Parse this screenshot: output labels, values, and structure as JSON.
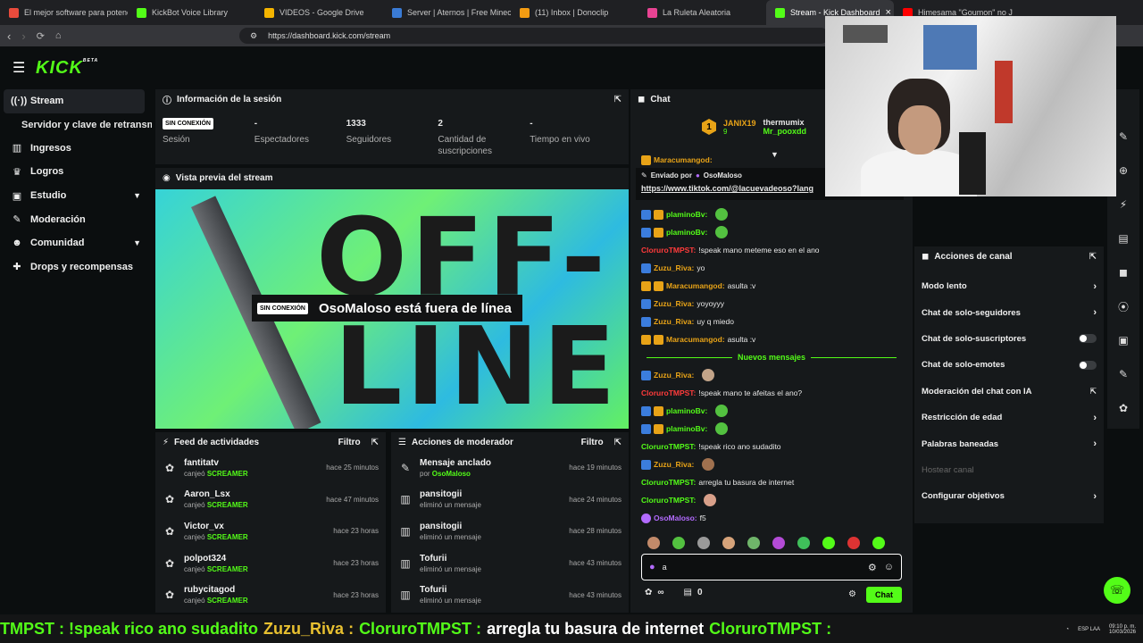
{
  "browser": {
    "tabs": [
      {
        "label": "El mejor software para potenci",
        "color": "#e84b3c"
      },
      {
        "label": "KickBot Voice Library",
        "color": "#53fc18"
      },
      {
        "label": "VIDEOS - Google Drive",
        "color": "#f4b400"
      },
      {
        "label": "Server | Aternos | Free Minecra",
        "color": "#3a7bd5"
      },
      {
        "label": "(11) Inbox | Donoclip",
        "color": "#f39c12"
      },
      {
        "label": "La Ruleta Aleatoria",
        "color": "#e84393"
      },
      {
        "label": "Stream - Kick Dashboard",
        "color": "#53fc18"
      },
      {
        "label": "Himesama \"Goumon\" no J",
        "color": "#ff0000"
      }
    ],
    "url": "https://dashboard.kick.com/stream"
  },
  "logo": "KICK",
  "logo_sup": "BETA",
  "sidebar": {
    "items": [
      {
        "label": "Stream",
        "icon": "broadcast"
      },
      {
        "label": "Servidor y clave de retransm"
      },
      {
        "label": "Ingresos",
        "icon": "chart"
      },
      {
        "label": "Logros",
        "icon": "trophy"
      },
      {
        "label": "Estudio",
        "icon": "studio"
      },
      {
        "label": "Moderación",
        "icon": "wrench"
      },
      {
        "label": "Comunidad",
        "icon": "people"
      },
      {
        "label": "Drops y recompensas",
        "icon": "gift"
      }
    ]
  },
  "session": {
    "title": "Información de la sesión",
    "status_badge": "SIN CONEXIÓN",
    "cols": [
      {
        "value": "",
        "label": "Sesión"
      },
      {
        "value": "-",
        "label": "Espectadores"
      },
      {
        "value": "1333",
        "label": "Seguidores"
      },
      {
        "value": "2",
        "label": "Cantidad de suscripciones"
      },
      {
        "value": "-",
        "label": "Tiempo en vivo"
      }
    ]
  },
  "preview": {
    "title": "Vista previa del stream",
    "badge": "SIN CONEXIÓN",
    "offline_text": "OsoMaloso está fuera de línea",
    "big_line1": "OFF-",
    "big_line2": "LINE"
  },
  "feed": {
    "title": "Feed de actividades",
    "filter": "Filtro",
    "rows": [
      {
        "name": "fantitatv",
        "action": "canjeó",
        "item": "SCREAMER",
        "time": "hace 25 minutos"
      },
      {
        "name": "Aaron_Lsx",
        "action": "canjeó",
        "item": "SCREAMER",
        "time": "hace 47 minutos"
      },
      {
        "name": "Victor_vx",
        "action": "canjeó",
        "item": "SCREAMER",
        "time": "hace 23 horas"
      },
      {
        "name": "polpot324",
        "action": "canjeó",
        "item": "SCREAMER",
        "time": "hace 23 horas"
      },
      {
        "name": "rubycitagod",
        "action": "canjeó",
        "item": "SCREAMER",
        "time": "hace 23 horas"
      }
    ]
  },
  "mod": {
    "title": "Acciones de moderador",
    "filter": "Filtro",
    "rows": [
      {
        "name": "Mensaje anclado",
        "action": "por",
        "item": "OsoMaloso",
        "time": "hace 19 minutos",
        "icon": "pin"
      },
      {
        "name": "pansitogii",
        "action": "eliminó un mensaje",
        "item": "",
        "time": "hace 24 minutos",
        "icon": "trash"
      },
      {
        "name": "pansitogii",
        "action": "eliminó un mensaje",
        "item": "",
        "time": "hace 28 minutos",
        "icon": "trash"
      },
      {
        "name": "Tofurii",
        "action": "eliminó un mensaje",
        "item": "",
        "time": "hace 43 minutos",
        "icon": "trash"
      },
      {
        "name": "Tofurii",
        "action": "eliminó un mensaje",
        "item": "",
        "time": "hace 43 minutos",
        "icon": "trash"
      }
    ]
  },
  "chat": {
    "title": "Chat",
    "top_gifter": {
      "rank": "1",
      "name": "JANIX19",
      "count": "9"
    },
    "gifters": [
      "thermumix",
      "Mr_pooxdd"
    ],
    "partial_top": "Maracumangod:",
    "pinned_by_label": "Enviado por",
    "pinned_by": "OsoMaloso",
    "pinned_link": "https://www.tiktok.com/@lacuevadeoso?lang",
    "messages": [
      {
        "user": "plaminoBv:",
        "text": "",
        "color": "#53fc18",
        "badges": [
          "blue",
          "gold"
        ],
        "emote": "#53c140"
      },
      {
        "user": "plaminoBv:",
        "text": "",
        "color": "#53fc18",
        "badges": [
          "blue",
          "gold"
        ],
        "emote": "#53c140"
      },
      {
        "user": "CloruroTMPST:",
        "text": "!speak mano meteme eso en el ano",
        "color": "#ff3b3b",
        "badges": []
      },
      {
        "user": "Zuzu_Riva:",
        "text": "yo",
        "color": "#e8a317",
        "badges": [
          "blue"
        ]
      },
      {
        "user": "Maracumangod:",
        "text": "asulta :v",
        "color": "#e8a317",
        "badges": [
          "gold",
          "gold"
        ]
      },
      {
        "user": "Zuzu_Riva:",
        "text": "yoyoyyy",
        "color": "#e8a317",
        "badges": [
          "blue"
        ]
      },
      {
        "user": "Zuzu_Riva:",
        "text": "uy q miedo",
        "color": "#e8a317",
        "badges": [
          "blue"
        ]
      },
      {
        "user": "Maracumangod:",
        "text": "asulta :v",
        "color": "#e8a317",
        "badges": [
          "gold",
          "gold"
        ]
      }
    ],
    "new_messages_label": "Nuevos mensajes",
    "messages2": [
      {
        "user": "Zuzu_Riva:",
        "text": "",
        "color": "#e8a317",
        "badges": [
          "blue"
        ],
        "emote": "#c2a489"
      },
      {
        "user": "CloruroTMPST:",
        "text": "!speak mano te afeitas el ano?",
        "color": "#ff3b3b",
        "badges": []
      },
      {
        "user": "plaminoBv:",
        "text": "",
        "color": "#53fc18",
        "badges": [
          "blue",
          "gold"
        ],
        "emote": "#53c140"
      },
      {
        "user": "plaminoBv:",
        "text": "",
        "color": "#53fc18",
        "badges": [
          "blue",
          "gold"
        ],
        "emote": "#53c140"
      },
      {
        "user": "CloruroTMPST:",
        "text": "!speak rico ano sudadito",
        "color": "#53fc18",
        "badges": []
      },
      {
        "user": "Zuzu_Riva:",
        "text": "",
        "color": "#e8a317",
        "badges": [
          "blue"
        ],
        "emote": "#a0714f"
      },
      {
        "user": "CloruroTMPST:",
        "text": "arregla tu basura de internet",
        "color": "#53fc18",
        "badges": []
      },
      {
        "user": "CloruroTMPST:",
        "text": "",
        "color": "#53fc18",
        "badges": [],
        "emote": "#d8a08a"
      },
      {
        "user": "OsoMaloso:",
        "text": "f5",
        "color": "#b36bff",
        "badges": [
          "mic"
        ]
      }
    ],
    "emote_colors": [
      "#c28a6a",
      "#53c140",
      "#9a9a9a",
      "#d6a37a",
      "#6fb56a",
      "#b34bd6",
      "#3fbf5a",
      "#53fc18",
      "#d33",
      "#53fc18"
    ],
    "input_value": "a",
    "infinity": "∞",
    "gift_count": "0",
    "send_label": "Chat"
  },
  "actions": {
    "title": "Acciones de canal",
    "items": [
      {
        "label": "Modo lento",
        "kind": "chevron"
      },
      {
        "label": "Chat de solo-seguidores",
        "kind": "chevron"
      },
      {
        "label": "Chat de solo-suscriptores",
        "kind": "toggle"
      },
      {
        "label": "Chat de solo-emotes",
        "kind": "toggle"
      },
      {
        "label": "Moderación del chat con IA",
        "kind": "external"
      },
      {
        "label": "Restricción de edad",
        "kind": "chevron"
      },
      {
        "label": "Palabras baneadas",
        "kind": "chevron"
      },
      {
        "label": "Hostear canal",
        "kind": "disabled"
      },
      {
        "label": "Configurar objetivos",
        "kind": "chevron"
      }
    ]
  },
  "ticker": [
    {
      "text": "TMPST : !speak rico ano sudadito",
      "color": "#53fc18"
    },
    {
      "text": "Zuzu_Riva :",
      "color": "#e8c030"
    },
    {
      "text": "CloruroTMPST :",
      "color": "#53fc18"
    },
    {
      "text": "arregla tu basura de internet",
      "color": "#ffffff"
    },
    {
      "text": "CloruroTMPST :",
      "color": "#53fc18"
    }
  ],
  "clock": {
    "lang": "ESP LAA",
    "time": "09:10 p. m.",
    "date": "10/03/2026"
  }
}
